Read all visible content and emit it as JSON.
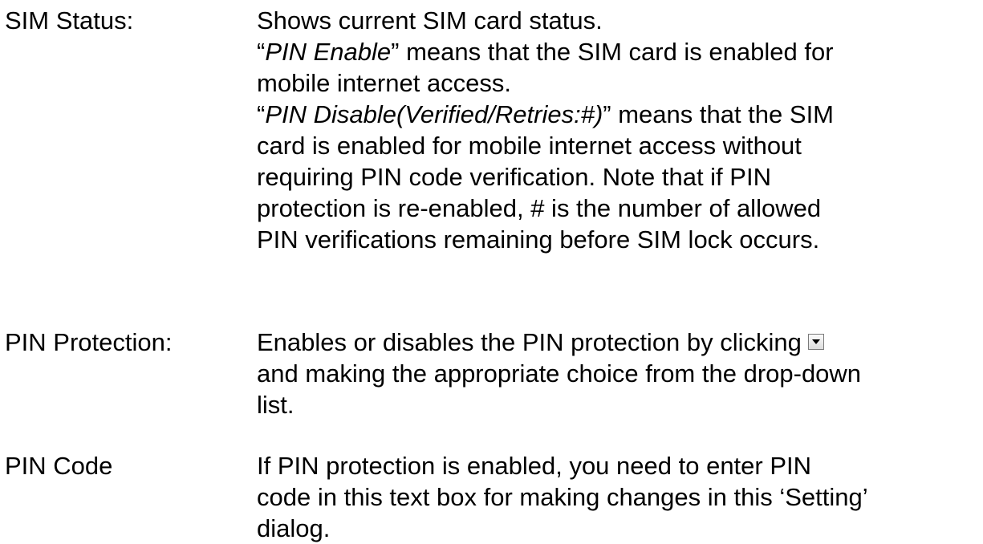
{
  "entries": [
    {
      "term": "SIM Status:",
      "lines": [
        "Shows current SIM card status.",
        [
          "“",
          "PIN Enable",
          "” means that the SIM card is enabled for"
        ],
        "mobile internet access.",
        [
          "“",
          "PIN Disable(Verified/Retries:#)",
          "” means that the SIM"
        ],
        "card is enabled for mobile internet access without",
        "requiring PIN code verification. Note that if PIN",
        "protection is re-enabled, # is the number of allowed",
        "PIN verifications remaining before SIM lock occurs."
      ]
    },
    {
      "term": "PIN Protection:",
      "lines": [
        "Enables or disables the PIN protection by clicking",
        "and making the appropriate choice from the drop-down",
        "list."
      ],
      "icon": "dropdown-arrow-icon"
    },
    {
      "term": "PIN Code",
      "lines": [
        "If PIN protection is enabled, you need to enter PIN",
        "code in this text box for making changes in this ‘Setting’",
        "dialog."
      ]
    }
  ]
}
